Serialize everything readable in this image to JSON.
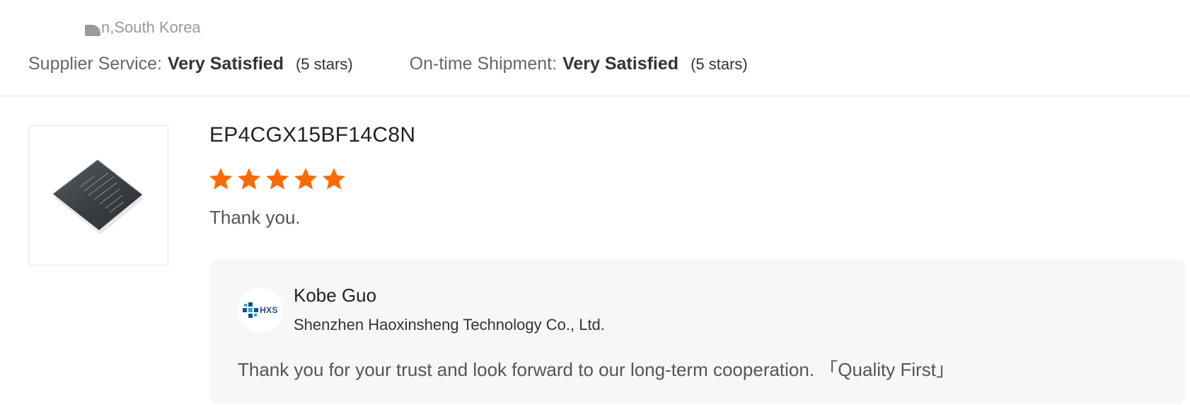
{
  "review": {
    "location": "n,South Korea",
    "supplier_service": {
      "label": "Supplier Service:",
      "value": "Very Satisfied",
      "stars": "(5 stars)"
    },
    "ontime_shipment": {
      "label": "On-time Shipment:",
      "value": "Very Satisfied",
      "stars": "(5 stars)"
    }
  },
  "product": {
    "title": "EP4CGX15BF14C8N",
    "rating": 5,
    "rating_max": 5,
    "star_color": "#ff6a00",
    "comment": "Thank you.",
    "image_icon": "chip-icon"
  },
  "reply": {
    "name": "Kobe Guo",
    "company": "Shenzhen Haoxinsheng Technology Co., Ltd.",
    "logo_text": "HXS",
    "text": "Thank you for your trust and look forward to our long-term cooperation. 「Quality First」"
  }
}
